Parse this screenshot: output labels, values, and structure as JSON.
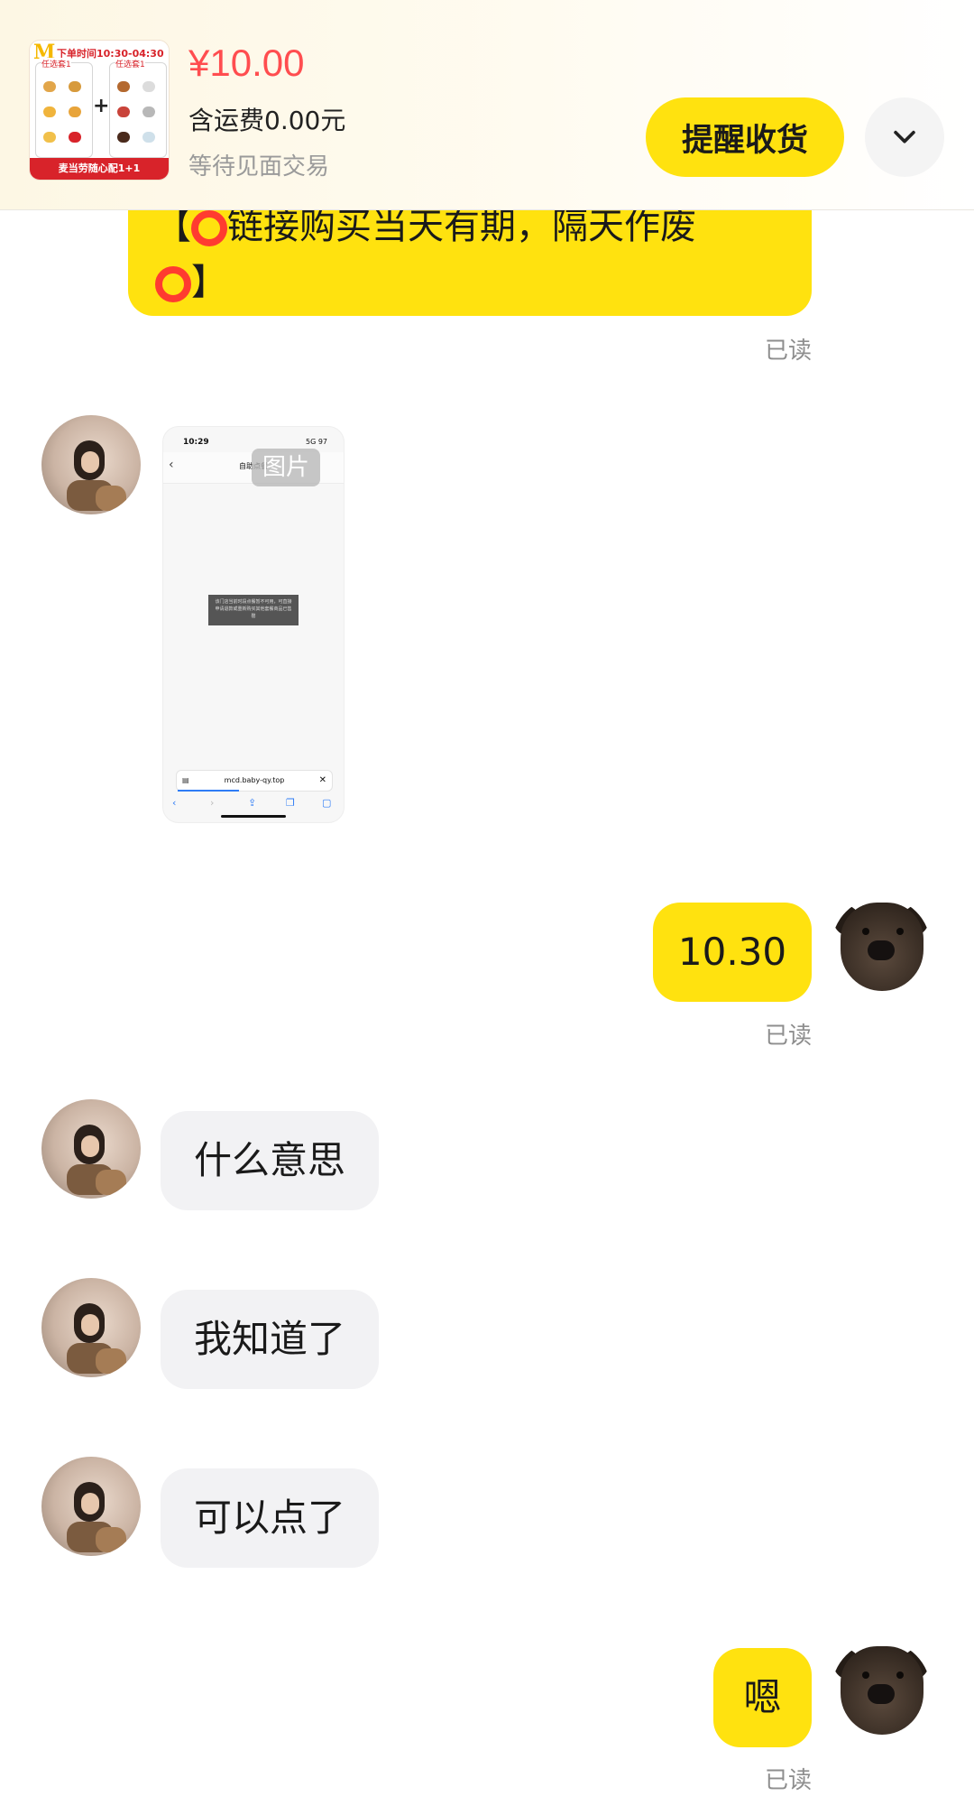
{
  "header": {
    "product_thumb": {
      "time_text": "下单时间10:30-04:30",
      "left_label": "任选套1",
      "right_label": "任选套1",
      "banner_text": "麦当劳随心配1+1"
    },
    "price": "¥10.00",
    "shipping": "含运费0.00元",
    "status": "等待见面交易",
    "remind_button": "提醒收货",
    "more_icon": "chevron-down-icon"
  },
  "messages": {
    "m1": {
      "line1_pre": "【",
      "line1_text": "链接购买当天有期，隔天作废",
      "line2_post": "】",
      "read": "已读"
    },
    "m2": {
      "image_tag": "图片",
      "screenshot": {
        "status_time": "10:29",
        "status_right": "5G 97",
        "nav_title": "自助点餐",
        "toast_text": "该门店当前时段点餐暂不可用，可直接申请退款或重新购买其他套餐商品已售罄",
        "url": "mcd.baby-qy.top"
      }
    },
    "m3": {
      "text": "10.30",
      "read": "已读"
    },
    "m4": {
      "text": "什么意思"
    },
    "m5": {
      "text": "我知道了"
    },
    "m6": {
      "text": "可以点了"
    },
    "m7": {
      "text": "嗯",
      "read": "已读"
    }
  },
  "colors": {
    "accent_yellow": "#ffe20f",
    "price_red": "#ff4d4f",
    "peer_bubble": "#f2f2f4",
    "read_gray": "#8e8e8e"
  }
}
